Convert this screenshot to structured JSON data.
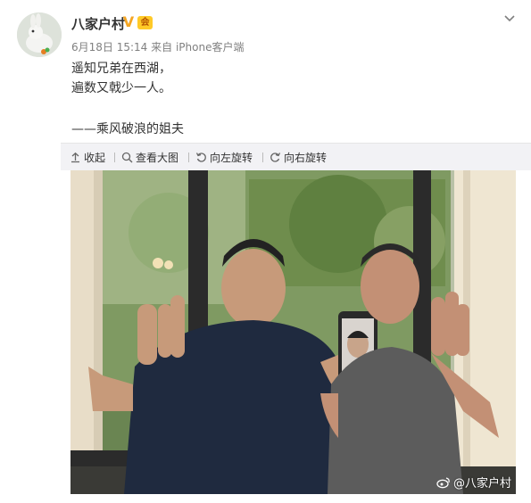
{
  "post": {
    "username": "八家户村",
    "verified_badge": "V",
    "level_badge": "会",
    "date": "6月18日 15:14",
    "source": "来自 iPhone客户端",
    "content_lines": [
      "遥知兄弟在西湖，",
      "遍数又戟少一人。"
    ],
    "signature": "——乘风破浪的姐夫"
  },
  "toolbar": {
    "collapse": "收起",
    "view_large": "查看大图",
    "rotate_left": "向左旋转",
    "rotate_right": "向右旋转"
  },
  "photo": {
    "watermark": "@八家户村",
    "icons": [
      "weibo-logo"
    ]
  },
  "colors": {
    "accent": "#f5a623",
    "meta_text": "#808080",
    "toolbar_bg": "#f2f2f5"
  }
}
